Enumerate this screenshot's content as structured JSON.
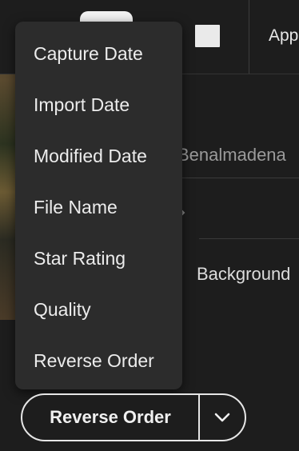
{
  "toolbar": {
    "app_label": "App"
  },
  "background": {
    "filename_label": "Benalmadena",
    "panel_label": "Background"
  },
  "sort_menu": {
    "items": [
      {
        "label": "Capture Date"
      },
      {
        "label": "Import Date"
      },
      {
        "label": "Modified Date"
      },
      {
        "label": "File Name"
      },
      {
        "label": "Star Rating"
      },
      {
        "label": "Quality"
      },
      {
        "label": "Reverse Order"
      }
    ]
  },
  "sort_control": {
    "label": "Reverse Order",
    "chevron_icon": "chevron-down-icon"
  },
  "colors": {
    "background": "#1d1d1d",
    "menu_background": "#2c2c2c",
    "text": "#ececec",
    "outline": "#e6e6e6"
  }
}
